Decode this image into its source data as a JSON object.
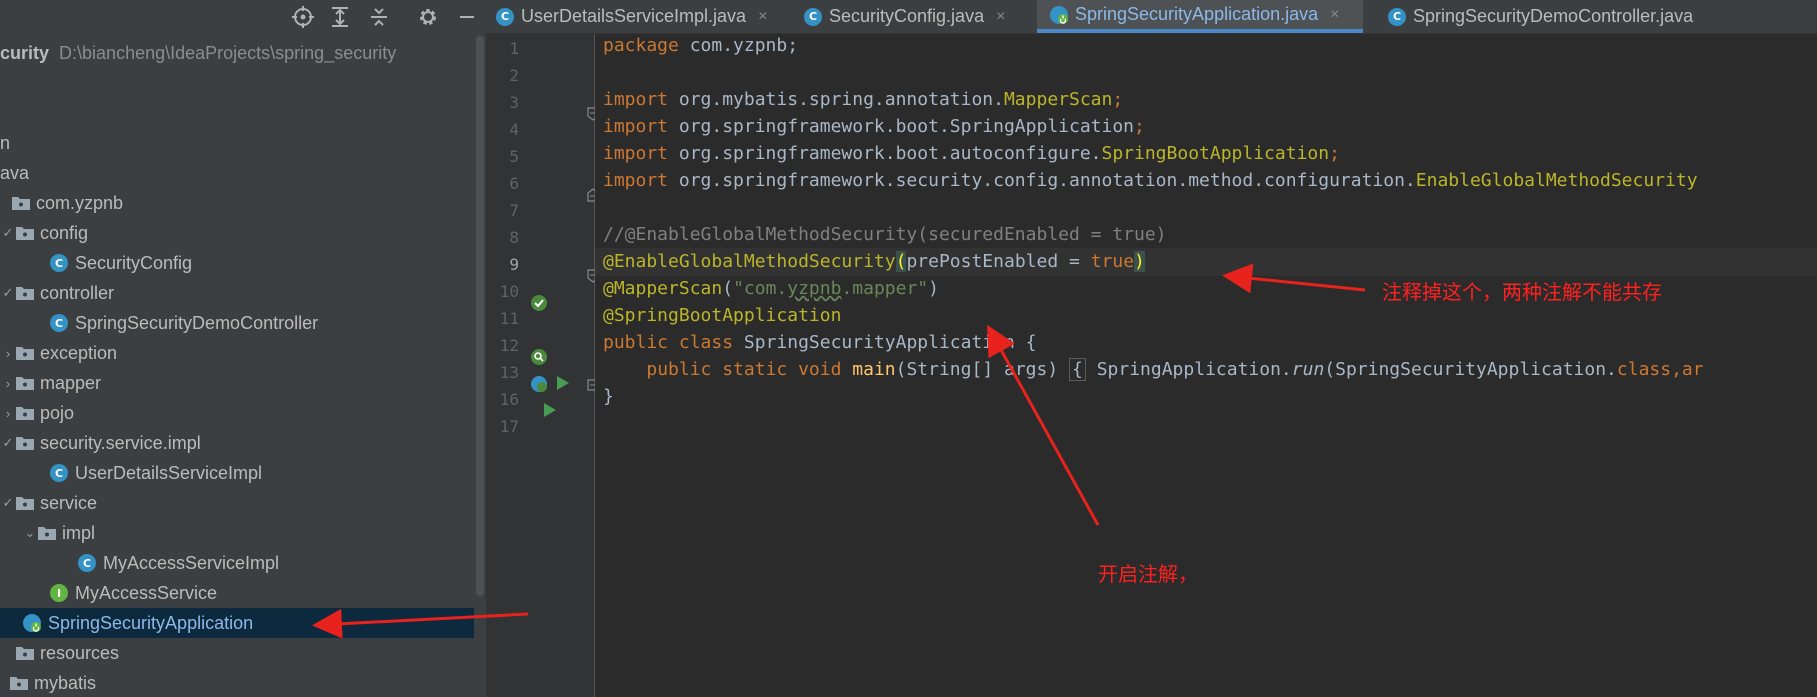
{
  "toolbar": {
    "icons": [
      "target-icon",
      "expand-all-icon",
      "collapse-all-icon",
      "gear-icon",
      "minimize-icon"
    ]
  },
  "project": {
    "root_label": "curity",
    "root_path": "D:\\biancheng\\IdeaProjects\\spring_security",
    "tree": [
      {
        "label": "n",
        "type": "folder-partial"
      },
      {
        "label": "ava",
        "type": "folder-partial"
      },
      {
        "label": "com.yzpnb",
        "type": "package"
      },
      {
        "label": "config",
        "type": "package"
      },
      {
        "label": "SecurityConfig",
        "type": "class"
      },
      {
        "label": "controller",
        "type": "package"
      },
      {
        "label": "SpringSecurityDemoController",
        "type": "class"
      },
      {
        "label": "exception",
        "type": "package"
      },
      {
        "label": "mapper",
        "type": "package"
      },
      {
        "label": "pojo",
        "type": "package"
      },
      {
        "label": "security.service.impl",
        "type": "package"
      },
      {
        "label": "UserDetailsServiceImpl",
        "type": "class"
      },
      {
        "label": "service",
        "type": "package"
      },
      {
        "label": "impl",
        "type": "package"
      },
      {
        "label": "MyAccessServiceImpl",
        "type": "class"
      },
      {
        "label": "MyAccessService",
        "type": "interface"
      },
      {
        "label": "SpringSecurityApplication",
        "type": "boot-class",
        "selected": true
      },
      {
        "label": "resources",
        "type": "folder"
      },
      {
        "label": "mybatis",
        "type": "folder"
      }
    ]
  },
  "tabs": [
    {
      "label": "UserDetailsServiceImpl.java",
      "active": false
    },
    {
      "label": "SecurityConfig.java",
      "active": false
    },
    {
      "label": "SpringSecurityApplication.java",
      "active": true
    },
    {
      "label": "SpringSecurityDemoController.java",
      "active": false
    }
  ],
  "tab_close_glyph": "×",
  "class_icon_letter": "C",
  "interface_icon_letter": "I",
  "editor": {
    "line_numbers": [
      "1",
      "2",
      "3",
      "4",
      "5",
      "6",
      "7",
      "8",
      "9",
      "10",
      "11",
      "12",
      "13",
      "16",
      "17"
    ],
    "lines": {
      "l1_kw": "package ",
      "l1_rest": "com.yzpnb;",
      "l3_kw": "import ",
      "l3_pkg": "org.mybatis.spring.annotation.",
      "l3_cls": "MapperScan",
      "l4_kw": "import ",
      "l4_pkg": "org.springframework.boot.SpringApplication",
      "l5_kw": "import ",
      "l5_pkg": "org.springframework.boot.autoconfigure.",
      "l5_cls": "SpringBootApplication",
      "l6_kw": "import ",
      "l6_pkg": "org.springframework.security.config.annotation.method.configuration.",
      "l6_cls": "EnableGlobalMethodSecurity",
      "semicolon": ";",
      "l8_comment": "//@EnableGlobalMethodSecurity(securedEnabled = true)",
      "l9_ann": "@EnableGlobalMethodSecurity",
      "l9_open": "(",
      "l9_param": "prePostEnabled = ",
      "l9_val": "true",
      "l9_close": ")",
      "l10_ann": "@MapperScan",
      "l10_open": "(",
      "l10_str_a": "\"com.",
      "l10_str_b": "yzpnb",
      "l10_str_c": ".mapper\"",
      "l10_close": ")",
      "l11_ann": "@SpringBootApplication",
      "l12_kw1": "public ",
      "l12_kw2": "class ",
      "l12_name": "SpringSecurityApplication {",
      "l13_indent": "    ",
      "l13_kw": "public static void ",
      "l13_fn": "main",
      "l13_params": "(String[] args) ",
      "l13_brace": "{",
      "l13_call_a": " SpringApplication.",
      "l13_call_run": "run",
      "l13_call_b": "(SpringSecurityApplication.",
      "l13_class_kw": "class",
      "l13_tail": ",ar",
      "l16": "}"
    }
  },
  "annotations": {
    "note_top": "注释掉这个，两种注解不能共存",
    "note_bottom": "开启注解，"
  },
  "colors": {
    "arrow": "#e8221c",
    "keyword": "#cc7832",
    "annotation": "#bbb529",
    "string": "#6a8759",
    "comment": "#808080",
    "selection": "#0d293e"
  }
}
